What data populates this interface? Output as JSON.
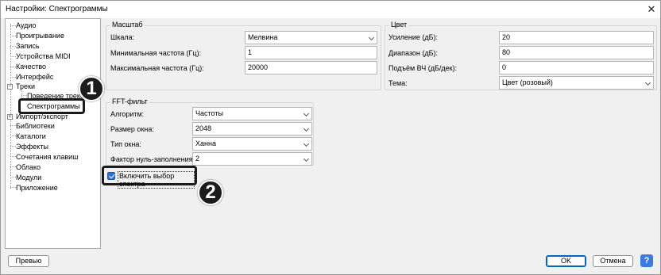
{
  "window": {
    "title": "Настройки: Спектрограммы",
    "close_glyph": "✕"
  },
  "tree": {
    "items": [
      {
        "label": "Аудио"
      },
      {
        "label": "Проигрывание"
      },
      {
        "label": "Запись"
      },
      {
        "label": "Устройства MIDI"
      },
      {
        "label": "Качество"
      },
      {
        "label": "Интерфейс"
      },
      {
        "label": "Треки"
      },
      {
        "label": "Поведение треков"
      },
      {
        "label": "Спектрограммы"
      },
      {
        "label": "Импорт/экспорт"
      },
      {
        "label": "Библиотеки"
      },
      {
        "label": "Каталоги"
      },
      {
        "label": "Эффекты"
      },
      {
        "label": "Сочетания клавиш"
      },
      {
        "label": "Облако"
      },
      {
        "label": "Модули"
      },
      {
        "label": "Приложение"
      }
    ],
    "expander_minus": "−",
    "expander_plus": "+"
  },
  "scale_group": {
    "title": "Масштаб",
    "scale_label": "Шкала:",
    "scale_value": "Мелвина",
    "min_freq_label": "Минимальная частота (Гц):",
    "min_freq_value": "1",
    "max_freq_label": "Максимальная частота (Гц):",
    "max_freq_value": "20000"
  },
  "color_group": {
    "title": "Цвет",
    "gain_label": "Усиление (дБ):",
    "gain_value": "20",
    "range_label": "Диапазон (дБ):",
    "range_value": "80",
    "hf_boost_label": "Подъём ВЧ (дБ/дек):",
    "hf_boost_value": "0",
    "scheme_label": "Тема:",
    "scheme_value": "Цвет (розовый)"
  },
  "fft_group": {
    "title": "FFT-фильт",
    "algorithm_label": "Алгоритм:",
    "algorithm_value": "Частоты",
    "window_size_label": "Размер окна:",
    "window_size_value": "2048",
    "window_type_label": "Тип окна:",
    "window_type_value": "Ханна",
    "zero_padding_label": "Фактор нуль-заполнения:",
    "zero_padding_value": "2"
  },
  "spectral_selection": {
    "label": "Включить выбор спектра",
    "checked": true
  },
  "badges": {
    "one": "1",
    "two": "2"
  },
  "buttons": {
    "preview": "Превью",
    "ok": "OK",
    "cancel": "Отмена",
    "help": "?"
  },
  "colors": {
    "accent": "#0067c0",
    "checkbox": "#2f6fd6",
    "badge": "#1c1c1c"
  }
}
